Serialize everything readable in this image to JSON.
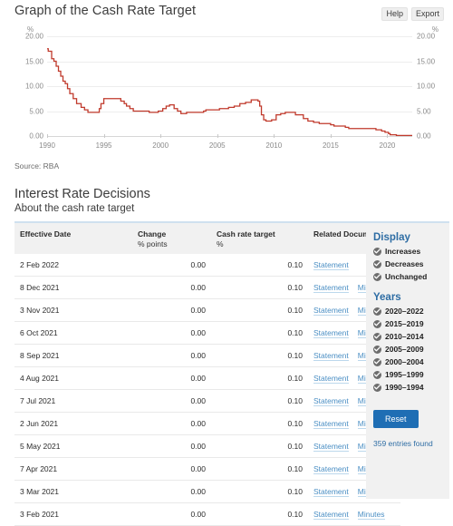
{
  "chart": {
    "title": "Graph of the Cash Rate Target",
    "actions": [
      {
        "label": "Help",
        "name": "help-button"
      },
      {
        "label": "Export",
        "name": "export-button"
      }
    ],
    "source": "Source: RBA"
  },
  "chart_data": {
    "type": "line",
    "title": "Graph of the Cash Rate Target",
    "xlabel": "",
    "ylabel": "%",
    "left_axis_unit": "%",
    "right_axis_unit": "%",
    "grid": true,
    "legend": false,
    "line_color": "#c0392b",
    "ylim": [
      0,
      20
    ],
    "yticks": [
      "0.00",
      "5.00",
      "10.00",
      "15.00",
      "20.00"
    ],
    "xlim": [
      1990,
      2022.2
    ],
    "xticks": [
      "1990",
      "1995",
      "2000",
      "2005",
      "2010",
      "2015",
      "2020"
    ],
    "series": [
      {
        "name": "Cash rate target",
        "x": [
          1990.0,
          1990.1,
          1990.4,
          1990.6,
          1990.8,
          1991.0,
          1991.2,
          1991.4,
          1991.6,
          1991.8,
          1992.0,
          1992.3,
          1992.6,
          1993.0,
          1993.3,
          1993.6,
          1994.0,
          1994.3,
          1994.6,
          1994.75,
          1995.0,
          1995.3,
          1996.0,
          1996.5,
          1996.8,
          1997.0,
          1997.3,
          1997.6,
          1998.0,
          1999.0,
          1999.8,
          2000.2,
          2000.5,
          2000.8,
          2001.0,
          2001.2,
          2001.5,
          2001.8,
          2002.3,
          2002.6,
          2003.0,
          2003.8,
          2004.0,
          2005.2,
          2006.0,
          2006.5,
          2007.0,
          2007.5,
          2008.0,
          2008.3,
          2008.6,
          2008.75,
          2008.9,
          2009.1,
          2009.3,
          2009.8,
          2010.2,
          2010.6,
          2011.0,
          2011.4,
          2011.9,
          2012.2,
          2012.6,
          2013.0,
          2013.5,
          2014.0,
          2015.0,
          2015.3,
          2016.3,
          2016.6,
          2017.0,
          2018.0,
          2019.0,
          2019.5,
          2019.8,
          2020.1,
          2020.25,
          2020.8,
          2021.0,
          2022.2
        ],
        "y": [
          17.5,
          17.0,
          15.5,
          15.0,
          14.0,
          13.0,
          12.0,
          11.0,
          10.5,
          9.5,
          8.5,
          7.5,
          6.5,
          5.75,
          5.25,
          4.75,
          4.75,
          4.75,
          5.5,
          6.5,
          7.5,
          7.5,
          7.5,
          7.0,
          6.5,
          6.0,
          5.5,
          5.0,
          5.0,
          4.75,
          5.0,
          5.5,
          6.0,
          6.25,
          6.25,
          5.5,
          5.0,
          4.5,
          4.75,
          4.75,
          4.75,
          5.0,
          5.25,
          5.5,
          5.75,
          6.0,
          6.5,
          6.75,
          7.25,
          7.25,
          7.0,
          6.0,
          4.25,
          3.25,
          3.0,
          3.25,
          4.25,
          4.5,
          4.75,
          4.75,
          4.25,
          4.25,
          3.5,
          3.0,
          2.75,
          2.5,
          2.25,
          2.0,
          1.75,
          1.5,
          1.5,
          1.5,
          1.25,
          1.0,
          0.75,
          0.5,
          0.25,
          0.1,
          0.1,
          0.1
        ]
      }
    ]
  },
  "decisions": {
    "heading": "Interest Rate Decisions",
    "subheading": "About the cash rate target",
    "columns": [
      {
        "label": "Effective Date",
        "unit": ""
      },
      {
        "label": "Change",
        "unit": "% points"
      },
      {
        "label": "Cash rate target",
        "unit": "%"
      },
      {
        "label": "Related Documents",
        "unit": ""
      }
    ],
    "rows": [
      {
        "date": "2 Feb 2022",
        "change": "0.00",
        "target": "0.10",
        "docs": [
          "Statement"
        ]
      },
      {
        "date": "8 Dec 2021",
        "change": "0.00",
        "target": "0.10",
        "docs": [
          "Statement",
          "Minutes"
        ]
      },
      {
        "date": "3 Nov 2021",
        "change": "0.00",
        "target": "0.10",
        "docs": [
          "Statement",
          "Minutes"
        ]
      },
      {
        "date": "6 Oct 2021",
        "change": "0.00",
        "target": "0.10",
        "docs": [
          "Statement",
          "Minutes"
        ]
      },
      {
        "date": "8 Sep 2021",
        "change": "0.00",
        "target": "0.10",
        "docs": [
          "Statement",
          "Minutes"
        ]
      },
      {
        "date": "4 Aug 2021",
        "change": "0.00",
        "target": "0.10",
        "docs": [
          "Statement",
          "Minutes"
        ]
      },
      {
        "date": "7 Jul 2021",
        "change": "0.00",
        "target": "0.10",
        "docs": [
          "Statement",
          "Minutes"
        ]
      },
      {
        "date": "2 Jun 2021",
        "change": "0.00",
        "target": "0.10",
        "docs": [
          "Statement",
          "Minutes"
        ]
      },
      {
        "date": "5 May 2021",
        "change": "0.00",
        "target": "0.10",
        "docs": [
          "Statement",
          "Minutes"
        ]
      },
      {
        "date": "7 Apr 2021",
        "change": "0.00",
        "target": "0.10",
        "docs": [
          "Statement",
          "Minutes"
        ]
      },
      {
        "date": "3 Mar 2021",
        "change": "0.00",
        "target": "0.10",
        "docs": [
          "Statement",
          "Minutes"
        ]
      },
      {
        "date": "3 Feb 2021",
        "change": "0.00",
        "target": "0.10",
        "docs": [
          "Statement",
          "Minutes"
        ]
      }
    ]
  },
  "sidebar": {
    "display_heading": "Display",
    "display_filters": [
      {
        "label": "Increases",
        "checked": true
      },
      {
        "label": "Decreases",
        "checked": true
      },
      {
        "label": "Unchanged",
        "checked": true
      }
    ],
    "years_heading": "Years",
    "year_filters": [
      {
        "label": "2020–2022",
        "checked": true
      },
      {
        "label": "2015–2019",
        "checked": true
      },
      {
        "label": "2010–2014",
        "checked": true
      },
      {
        "label": "2005–2009",
        "checked": true
      },
      {
        "label": "2000–2004",
        "checked": true
      },
      {
        "label": "1995–1999",
        "checked": true
      },
      {
        "label": "1990–1994",
        "checked": true
      }
    ],
    "reset_label": "Reset",
    "entries_found": "359 entries found"
  }
}
